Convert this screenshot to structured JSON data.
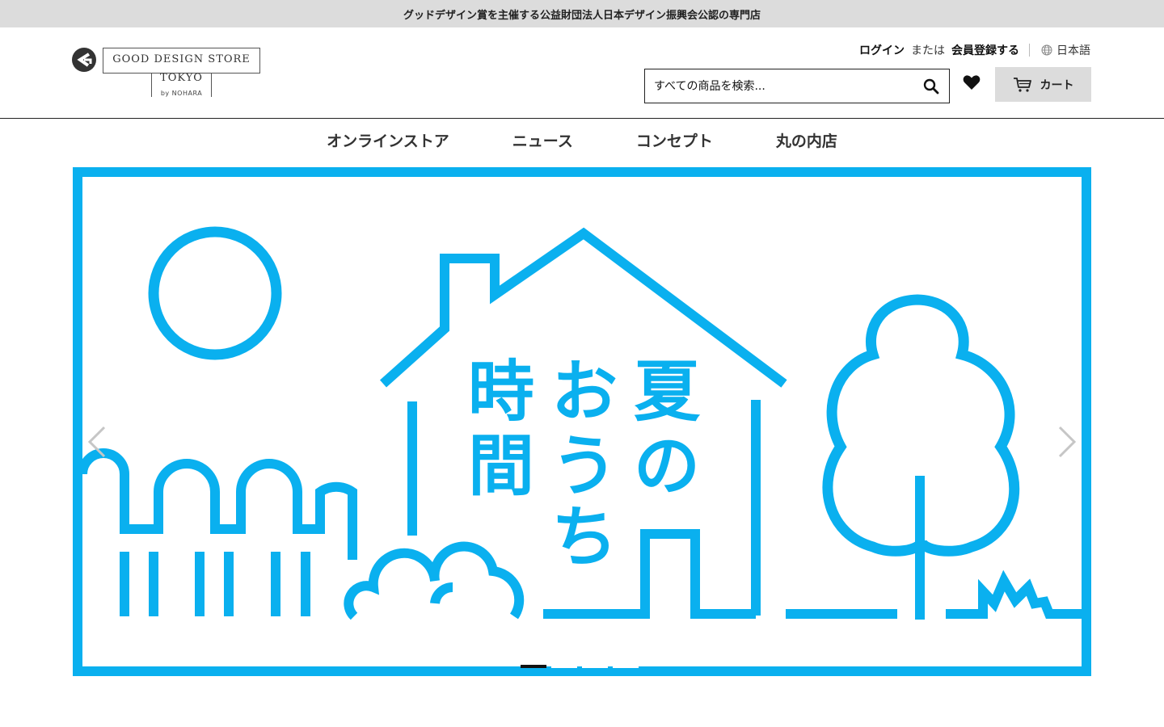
{
  "announcement": "グッドデザイン賞を主催する公益財団法人日本デザイン振興会公認の専門店",
  "logo": {
    "line1": "GOOD DESIGN STORE",
    "line2": "TOKYO",
    "line3": "by NOHARA"
  },
  "account": {
    "login": "ログイン",
    "or": "または",
    "register": "会員登録する",
    "language": "日本語"
  },
  "search": {
    "placeholder": "すべての商品を検索..."
  },
  "cart": {
    "label": "カート"
  },
  "nav": [
    {
      "label": "オンラインストア"
    },
    {
      "label": "ニュース"
    },
    {
      "label": "コンセプト"
    },
    {
      "label": "丸の内店"
    }
  ],
  "hero": {
    "title_col1": [
      "夏",
      "の"
    ],
    "title_col2": [
      "お",
      "う",
      "ち"
    ],
    "title_col3": [
      "時",
      "間"
    ],
    "slide_count": 4,
    "active_slide": 1,
    "accent_color": "#0ab0ef"
  }
}
